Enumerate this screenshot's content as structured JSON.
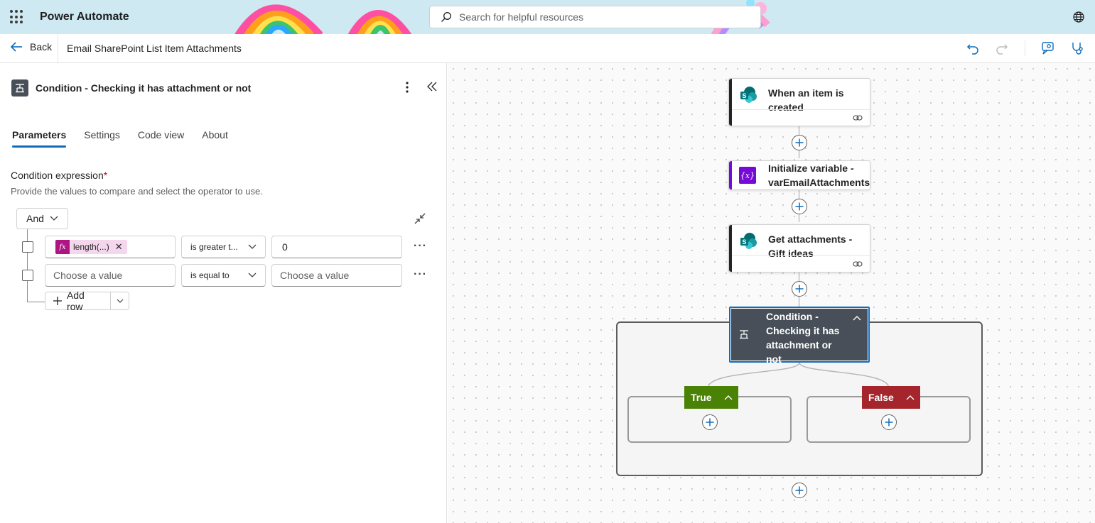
{
  "header": {
    "app_name": "Power Automate",
    "search_placeholder": "Search for helpful resources"
  },
  "commandbar": {
    "back_label": "Back",
    "flow_name": "Email SharePoint List Item Attachments"
  },
  "panel": {
    "title": "Condition - Checking it has attachment or not",
    "tabs": [
      "Parameters",
      "Settings",
      "Code view",
      "About"
    ],
    "active_tab": "Parameters",
    "condition_label": "Condition expression",
    "required_mark": "*",
    "condition_desc": "Provide the values to compare and select the operator to use.",
    "group_operator": "And",
    "rows": [
      {
        "left_token": "length(...)",
        "operator": "is greater t...",
        "right_value": "0"
      },
      {
        "left_placeholder": "Choose a value",
        "operator": "is equal to",
        "right_placeholder": "Choose a value"
      }
    ],
    "add_row_label": "Add row"
  },
  "canvas": {
    "cards": [
      {
        "title": "When an item is created",
        "icon": "sharepoint-icon"
      },
      {
        "title": "Initialize variable - varEmailAttachments",
        "icon": "variable-icon"
      },
      {
        "title": "Get attachments - Gift ideas",
        "icon": "sharepoint-icon"
      }
    ],
    "condition_title": "Condition - Checking it has attachment or not",
    "true_label": "True",
    "false_label": "False"
  },
  "colors": {
    "accent": "#0f6cbd",
    "true_green": "#498205",
    "false_red": "#a4262c",
    "variable_purple": "#770bd6",
    "condition_gray": "#484f58"
  }
}
